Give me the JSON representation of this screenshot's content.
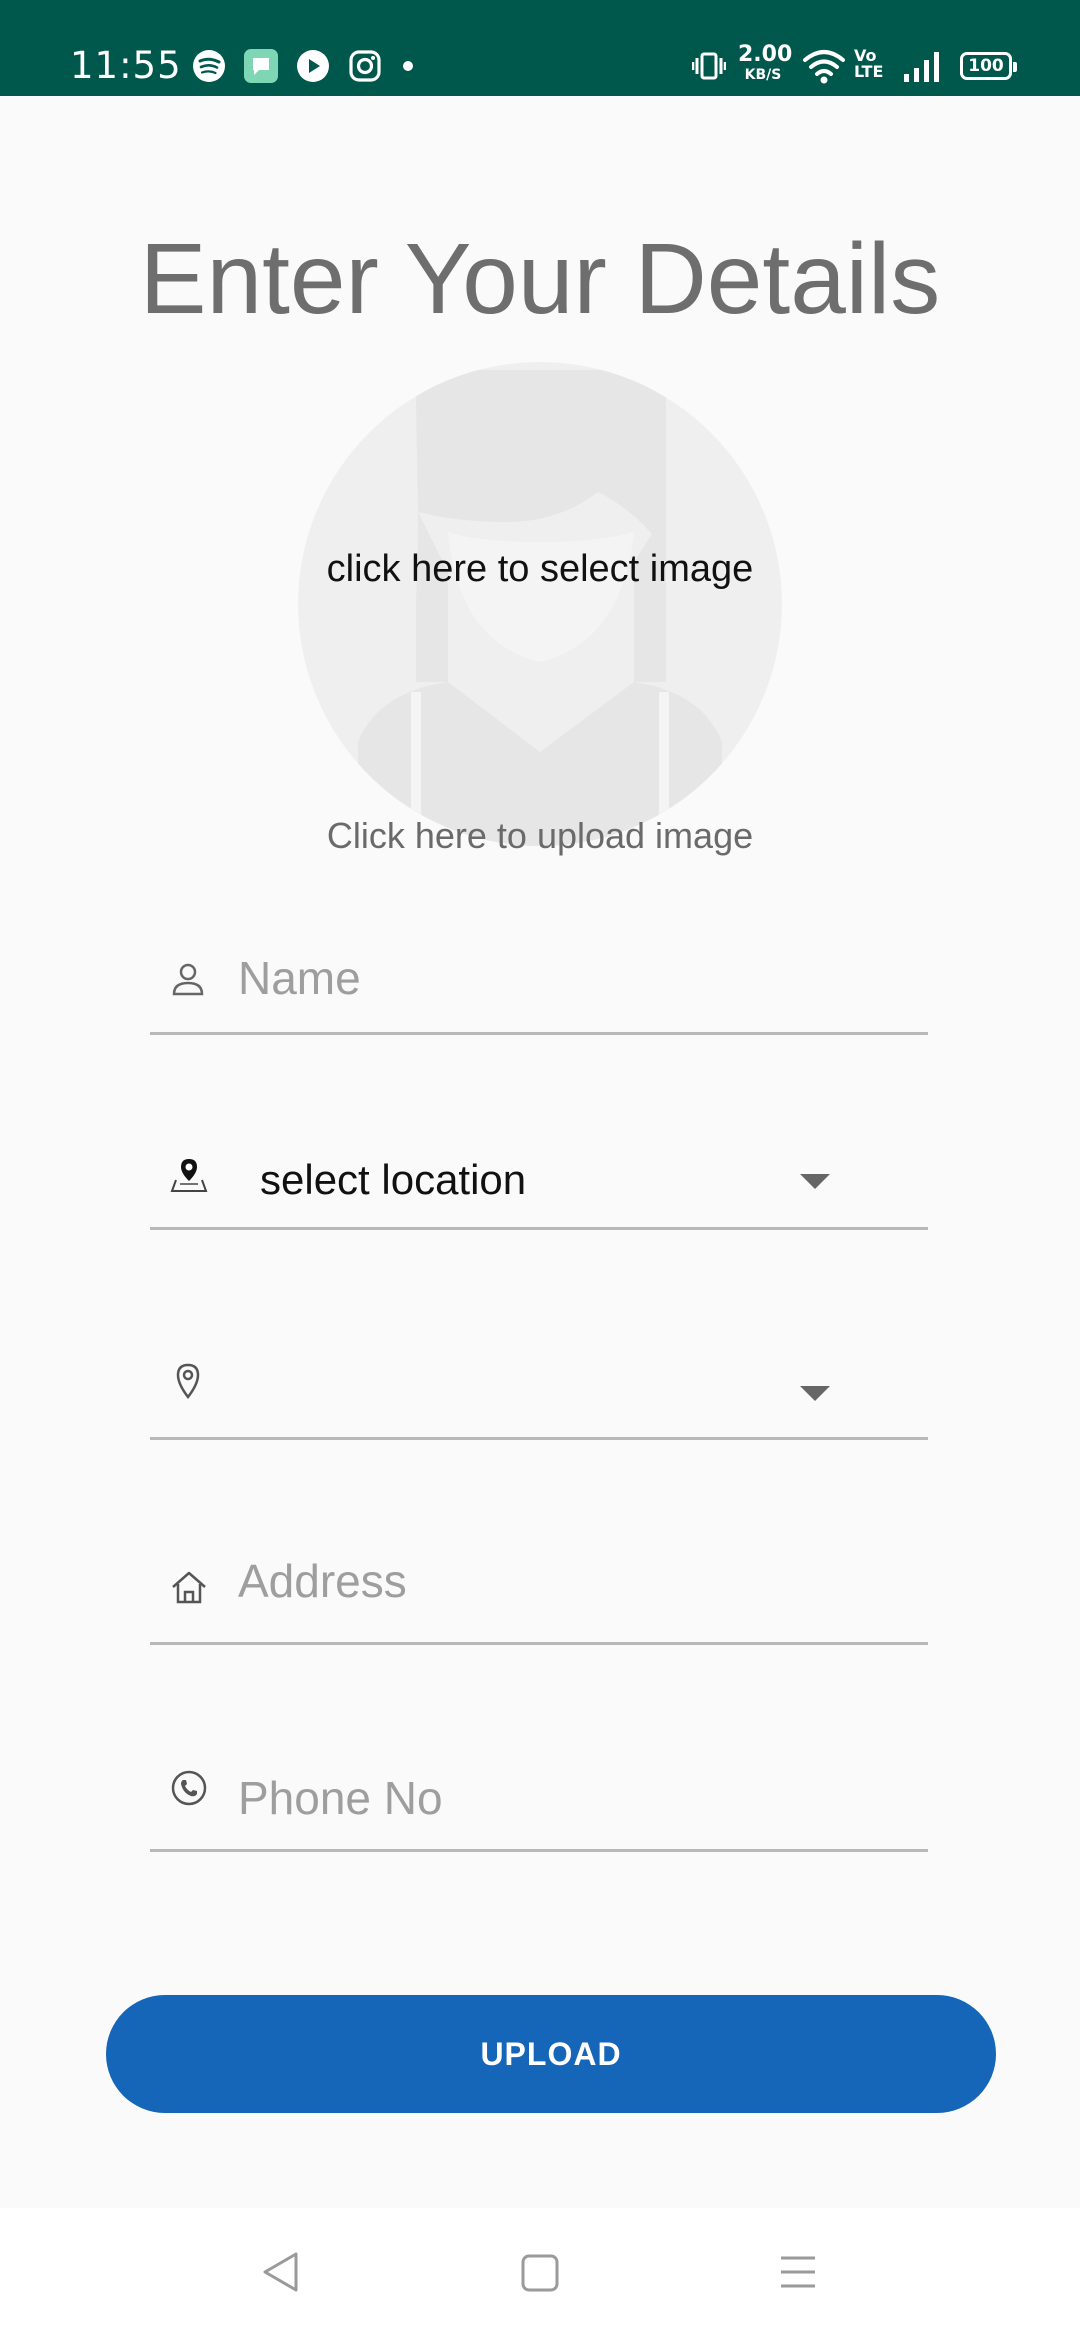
{
  "status_bar": {
    "time": "11:55",
    "notification_icons": [
      "spotify-icon",
      "chat-app-icon",
      "youtube-music-icon",
      "instagram-icon",
      "more-dot-icon"
    ],
    "network_speed_value": "2.00",
    "network_speed_unit": "KB/S",
    "volte_top": "Vo",
    "volte_bottom": "LTE",
    "battery_level": "100",
    "status_bar_color": "#00574b"
  },
  "page": {
    "title": "Enter Your Details"
  },
  "avatar": {
    "prompt": "click here to select image",
    "caption": "Click here to upload image"
  },
  "form": {
    "name_placeholder": "Name",
    "location_value": "select location",
    "sublocation_value": "",
    "address_placeholder": "Address",
    "phone_placeholder": "Phone No"
  },
  "actions": {
    "upload_label": "UPLOAD",
    "accent_color": "#1565b8"
  },
  "nav_bar": {
    "buttons": [
      "back-icon",
      "home-icon",
      "menu-icon"
    ]
  }
}
